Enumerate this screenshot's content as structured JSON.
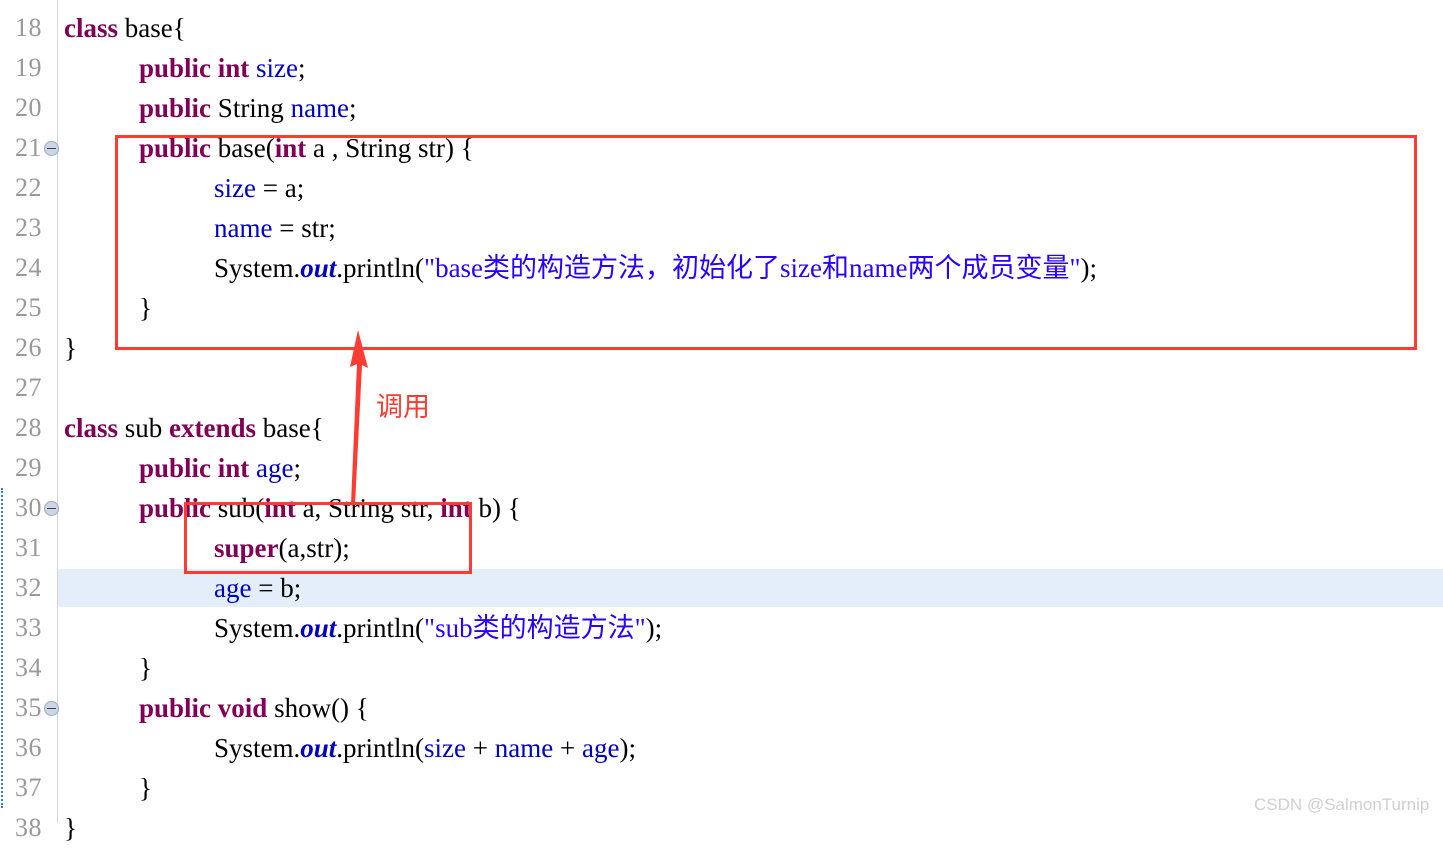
{
  "editor": {
    "language": "java",
    "gutter_line_numbers": [
      "18",
      "19",
      "20",
      "21",
      "22",
      "23",
      "24",
      "25",
      "26",
      "27",
      "28",
      "29",
      "30",
      "31",
      "32",
      "33",
      "34",
      "35",
      "36",
      "37",
      "38"
    ],
    "fold_markers_on_lines": [
      "21",
      "30",
      "35"
    ],
    "highlighted_line": "32",
    "colors": {
      "background": "#ffffff",
      "keyword": "#7f0055",
      "field": "#0000c0",
      "static_field": "#0000c0",
      "string": "#2a00ff",
      "plain_text": "#000000",
      "line_number": "#999999",
      "gutter_border": "#d4d4d4",
      "current_line_highlight": "#e4eefb",
      "annotation_red": "#fa3c32",
      "watermark": "#d0d0d0"
    },
    "lines": [
      {
        "num": "18",
        "indent": 0,
        "tokens": [
          {
            "t": "class",
            "c": "kw"
          },
          {
            "t": " base{",
            "c": "plain"
          }
        ]
      },
      {
        "num": "19",
        "indent": 1,
        "tokens": [
          {
            "t": "public int",
            "c": "kw"
          },
          {
            "t": " ",
            "c": "plain"
          },
          {
            "t": "size",
            "c": "fld"
          },
          {
            "t": ";",
            "c": "plain"
          }
        ]
      },
      {
        "num": "20",
        "indent": 1,
        "tokens": [
          {
            "t": "public",
            "c": "kw"
          },
          {
            "t": " String ",
            "c": "plain"
          },
          {
            "t": "name",
            "c": "fld"
          },
          {
            "t": ";",
            "c": "plain"
          }
        ]
      },
      {
        "num": "21",
        "indent": 1,
        "tokens": [
          {
            "t": "public",
            "c": "kw"
          },
          {
            "t": " base(",
            "c": "plain"
          },
          {
            "t": "int",
            "c": "kw"
          },
          {
            "t": " a , String str) {",
            "c": "plain"
          }
        ]
      },
      {
        "num": "22",
        "indent": 2,
        "tokens": [
          {
            "t": "size",
            "c": "fld"
          },
          {
            "t": " = a;",
            "c": "plain"
          }
        ]
      },
      {
        "num": "23",
        "indent": 2,
        "tokens": [
          {
            "t": "name",
            "c": "fld"
          },
          {
            "t": " = str;",
            "c": "plain"
          }
        ]
      },
      {
        "num": "24",
        "indent": 2,
        "tokens": [
          {
            "t": "System.",
            "c": "plain"
          },
          {
            "t": "out",
            "c": "sfld"
          },
          {
            "t": ".println(",
            "c": "plain"
          },
          {
            "t": "\"base类的构造方法，初始化了size和name两个成员变量\"",
            "c": "str"
          },
          {
            "t": ");",
            "c": "plain"
          }
        ]
      },
      {
        "num": "25",
        "indent": 1,
        "tokens": [
          {
            "t": "}",
            "c": "plain"
          }
        ]
      },
      {
        "num": "26",
        "indent": 0,
        "tokens": [
          {
            "t": "}",
            "c": "plain"
          }
        ]
      },
      {
        "num": "27",
        "indent": 0,
        "tokens": []
      },
      {
        "num": "28",
        "indent": 0,
        "tokens": [
          {
            "t": "class",
            "c": "kw"
          },
          {
            "t": " sub ",
            "c": "plain"
          },
          {
            "t": "extends",
            "c": "kw"
          },
          {
            "t": " base{",
            "c": "plain"
          }
        ]
      },
      {
        "num": "29",
        "indent": 1,
        "tokens": [
          {
            "t": "public int",
            "c": "kw"
          },
          {
            "t": " ",
            "c": "plain"
          },
          {
            "t": "age",
            "c": "fld"
          },
          {
            "t": ";",
            "c": "plain"
          }
        ]
      },
      {
        "num": "30",
        "indent": 1,
        "tokens": [
          {
            "t": "public",
            "c": "kw"
          },
          {
            "t": " sub(",
            "c": "plain"
          },
          {
            "t": "int",
            "c": "kw"
          },
          {
            "t": " a, String str, ",
            "c": "plain"
          },
          {
            "t": "int",
            "c": "kw"
          },
          {
            "t": " b) {",
            "c": "plain"
          }
        ]
      },
      {
        "num": "31",
        "indent": 2,
        "tokens": [
          {
            "t": "super",
            "c": "kw"
          },
          {
            "t": "(a,str);",
            "c": "plain"
          }
        ]
      },
      {
        "num": "32",
        "indent": 2,
        "tokens": [
          {
            "t": "age",
            "c": "fld"
          },
          {
            "t": " = b;",
            "c": "plain"
          }
        ]
      },
      {
        "num": "33",
        "indent": 2,
        "tokens": [
          {
            "t": "System.",
            "c": "plain"
          },
          {
            "t": "out",
            "c": "sfld"
          },
          {
            "t": ".println(",
            "c": "plain"
          },
          {
            "t": "\"sub类的构造方法\"",
            "c": "str"
          },
          {
            "t": ");",
            "c": "plain"
          }
        ]
      },
      {
        "num": "34",
        "indent": 1,
        "tokens": [
          {
            "t": "}",
            "c": "plain"
          }
        ]
      },
      {
        "num": "35",
        "indent": 1,
        "tokens": [
          {
            "t": "public void",
            "c": "kw"
          },
          {
            "t": " show() {",
            "c": "plain"
          }
        ]
      },
      {
        "num": "36",
        "indent": 2,
        "tokens": [
          {
            "t": "System.",
            "c": "plain"
          },
          {
            "t": "out",
            "c": "sfld"
          },
          {
            "t": ".println(",
            "c": "plain"
          },
          {
            "t": "size",
            "c": "fld"
          },
          {
            "t": " + ",
            "c": "plain"
          },
          {
            "t": "name",
            "c": "fld"
          },
          {
            "t": " + ",
            "c": "plain"
          },
          {
            "t": "age",
            "c": "fld"
          },
          {
            "t": ");",
            "c": "plain"
          }
        ]
      },
      {
        "num": "37",
        "indent": 1,
        "tokens": [
          {
            "t": "}",
            "c": "plain"
          }
        ]
      },
      {
        "num": "38",
        "indent": 0,
        "tokens": [
          {
            "t": "}",
            "c": "plain"
          }
        ]
      }
    ]
  },
  "annotations": {
    "constructor_box_label": "base constructor highlight",
    "super_box_label": "super call highlight",
    "arrow_label": "调用"
  },
  "watermark": {
    "text": "CSDN @SalmonTurnip"
  }
}
